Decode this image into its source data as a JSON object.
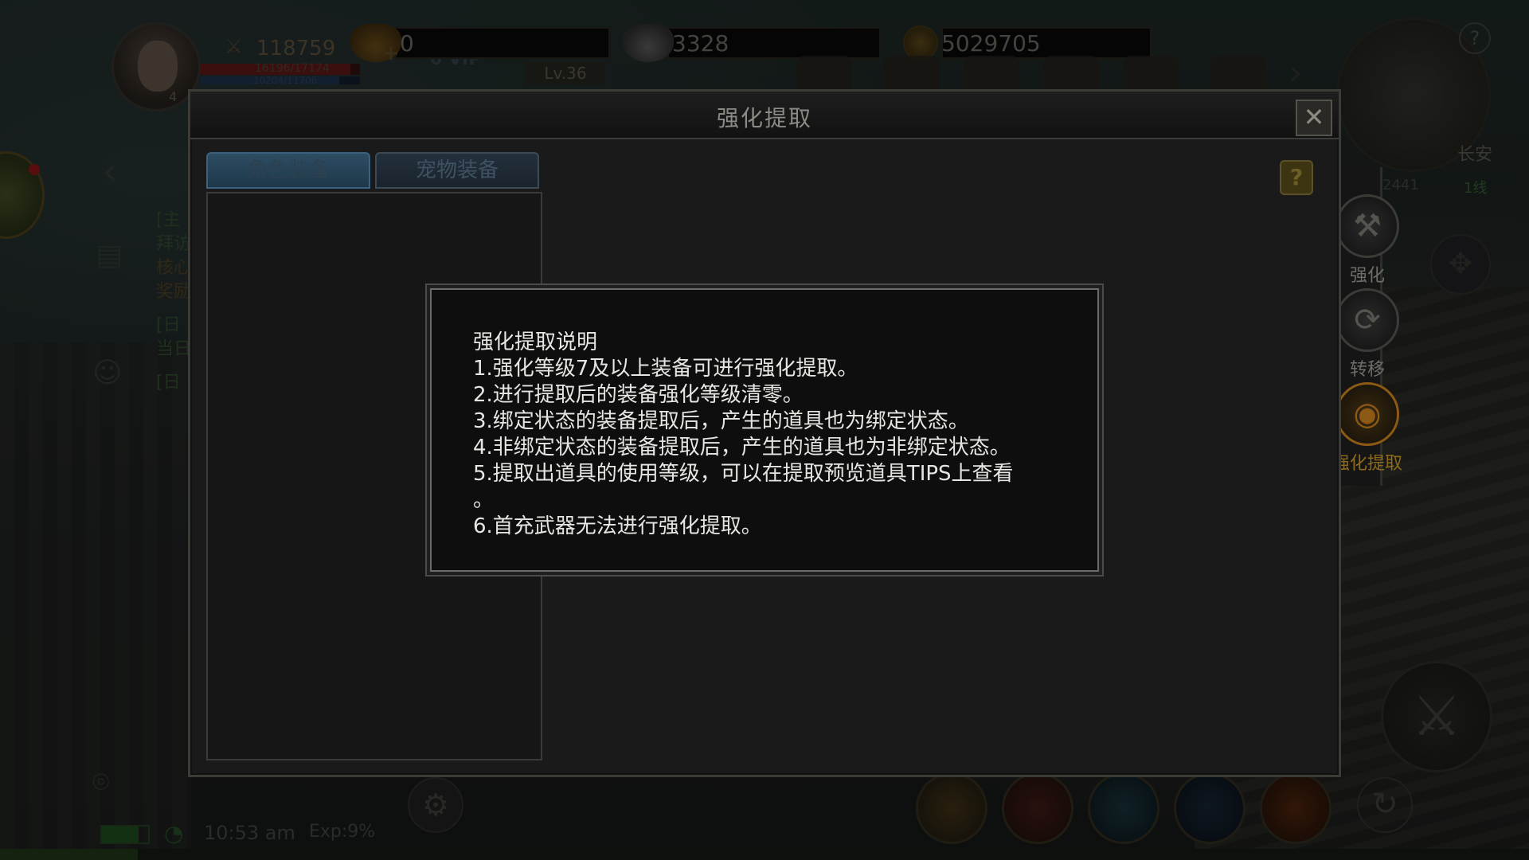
{
  "hud": {
    "player_level": "4",
    "combat_power": "118759",
    "hp_text": "16196/17174",
    "hp_fraction": 0.94,
    "mp_text": "10204/11706",
    "mp_fraction": 0.87,
    "vip_label": "VIP",
    "vip_level": "0",
    "level_badge": "Lv.36",
    "currencies": [
      {
        "name": "gold-ingot",
        "value": "0"
      },
      {
        "name": "silver-ingot",
        "value": "3328"
      },
      {
        "name": "coin",
        "value": "5029705"
      }
    ],
    "map_name": "长安",
    "map_coord": "2441",
    "map_line": "1线",
    "map_help": "?",
    "clock": "10:53 am",
    "exp": "Exp:9%",
    "battery_fraction": 0.8,
    "exp_fraction": 0.09
  },
  "left_quests": {
    "line1": "[主",
    "line2": "拜访",
    "line3": "核心",
    "line4": "奖励",
    "line5": "[日",
    "line6": "当日",
    "line7": "[日"
  },
  "window": {
    "title": "强化提取",
    "close_icon": "close-icon",
    "help_label": "?",
    "tabs": [
      {
        "label": "角色装备",
        "active": true
      },
      {
        "label": "宠物装备",
        "active": false
      }
    ],
    "background_hint": "装备"
  },
  "side_menu": [
    {
      "label": "强化",
      "icon": "hammer-icon",
      "active": false
    },
    {
      "label": "转移",
      "icon": "transfer-icon",
      "active": false
    },
    {
      "label": "强化提取",
      "icon": "extract-icon",
      "active": true
    }
  ],
  "popup": {
    "heading": "强化提取说明",
    "lines": [
      "1.强化等级7及以上装备可进行强化提取。",
      "2.进行提取后的装备强化等级清零。",
      "3.绑定状态的装备提取后，产生的道具也为绑定状态。",
      "4.非绑定状态的装备提取后，产生的道具也为非绑定状态。",
      "5.提取出道具的使用等级，可以在提取预览道具TIPS上查看",
      "。",
      "6.首充武器无法进行强化提取。"
    ]
  },
  "colors": {
    "accent_gold": "#8c5a14",
    "tab_active": "#2d4d63",
    "popup_text": "#e6e6e2"
  }
}
